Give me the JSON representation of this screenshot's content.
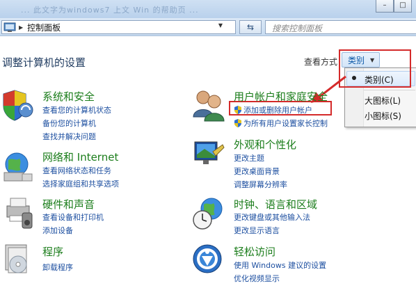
{
  "titlebar": {
    "blurred_text": "... 此文字为windows7 上文 Win 的帮助页 ..."
  },
  "nav": {
    "breadcrumb": "控制面板",
    "search_placeholder": "搜索控制面板"
  },
  "page": {
    "heading": "调整计算机的设置",
    "view_by_label": "查看方式：",
    "view_by_value": "类别"
  },
  "view_menu": {
    "items": [
      {
        "label": "类别(C)",
        "selected": true
      },
      {
        "label": "大图标(L)",
        "selected": false
      },
      {
        "label": "小图标(S)",
        "selected": false
      }
    ]
  },
  "categories": {
    "system": {
      "title": "系统和安全",
      "links": [
        "查看您的计算机状态",
        "备份您的计算机",
        "查找并解决问题"
      ]
    },
    "network": {
      "title": "网络和 Internet",
      "links": [
        "查看网络状态和任务",
        "选择家庭组和共享选项"
      ]
    },
    "hardware": {
      "title": "硬件和声音",
      "links": [
        "查看设备和打印机",
        "添加设备"
      ]
    },
    "programs": {
      "title": "程序",
      "links": [
        "卸载程序"
      ]
    },
    "users": {
      "title": "用户帐户和家庭安全",
      "links": [
        "添加或删除用户帐户",
        "为所有用户设置家长控制"
      ]
    },
    "appearance": {
      "title": "外观和个性化",
      "links": [
        "更改主题",
        "更改桌面背景",
        "调整屏幕分辨率"
      ]
    },
    "clock": {
      "title": "时钟、语言和区域",
      "links": [
        "更改键盘或其他输入法",
        "更改显示语言"
      ]
    },
    "ease": {
      "title": "轻松访问",
      "links": [
        "使用 Windows 建议的设置",
        "优化视频显示"
      ]
    }
  },
  "colors": {
    "category_title": "#1b7d1b",
    "link": "#1d4fa0",
    "annotation_red": "#d42a2a"
  }
}
